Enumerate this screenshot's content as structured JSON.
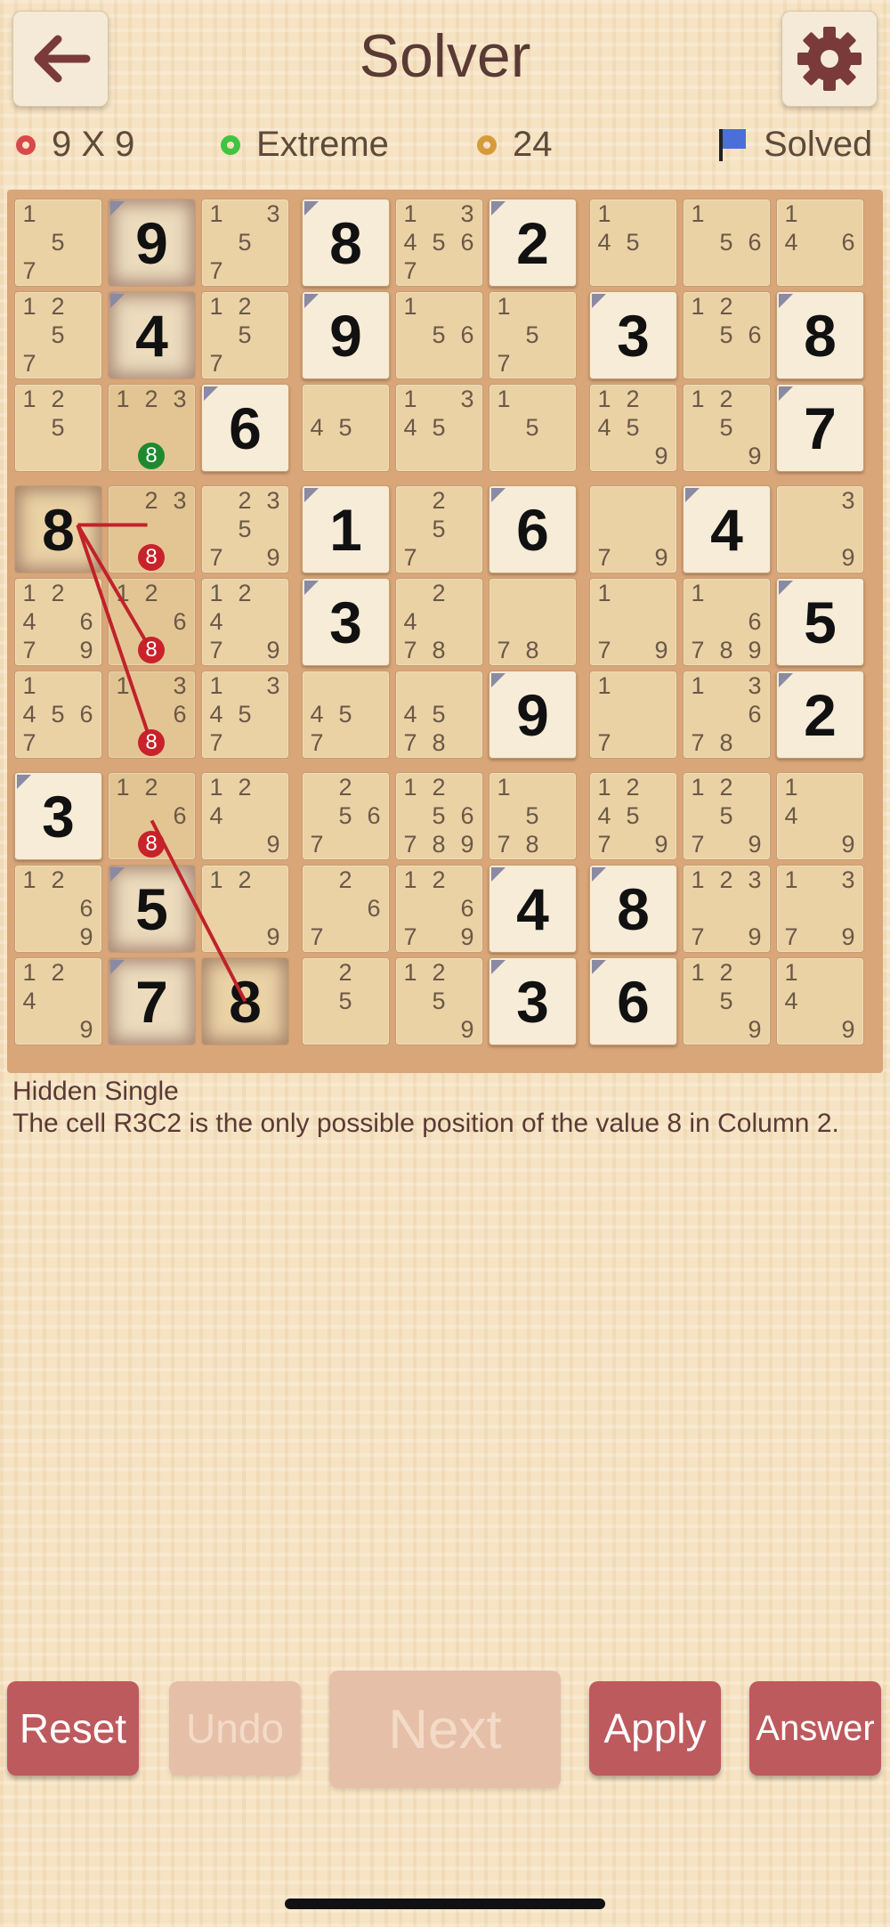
{
  "header": {
    "title": "Solver"
  },
  "status": {
    "size": "9 X 9",
    "difficulty": "Extreme",
    "count": "24",
    "state": "Solved",
    "colors": {
      "size": "#d84a4a",
      "difficulty": "#3fc43f",
      "count": "#d79a3a",
      "flag": "#4a6fd6"
    }
  },
  "board": {
    "given": [
      [
        0,
        9,
        0,
        8,
        0,
        2,
        0,
        0,
        0
      ],
      [
        0,
        4,
        0,
        9,
        0,
        0,
        3,
        0,
        8
      ],
      [
        0,
        0,
        6,
        0,
        0,
        0,
        0,
        0,
        7
      ],
      [
        8,
        0,
        0,
        1,
        0,
        6,
        0,
        4,
        0
      ],
      [
        0,
        0,
        0,
        3,
        0,
        0,
        0,
        0,
        5
      ],
      [
        0,
        0,
        0,
        0,
        0,
        9,
        0,
        0,
        2
      ],
      [
        3,
        0,
        0,
        0,
        0,
        0,
        0,
        0,
        0
      ],
      [
        0,
        5,
        0,
        0,
        0,
        4,
        8,
        0,
        0
      ],
      [
        0,
        7,
        8,
        0,
        0,
        3,
        6,
        0,
        0
      ]
    ],
    "prefilled": [
      [
        0,
        1,
        0,
        1,
        0,
        1,
        0,
        0,
        0
      ],
      [
        0,
        1,
        0,
        1,
        0,
        0,
        1,
        0,
        1
      ],
      [
        0,
        0,
        1,
        0,
        0,
        0,
        0,
        0,
        1
      ],
      [
        0,
        0,
        0,
        1,
        0,
        1,
        0,
        1,
        0
      ],
      [
        0,
        0,
        0,
        1,
        0,
        0,
        0,
        0,
        1
      ],
      [
        0,
        0,
        0,
        0,
        0,
        1,
        0,
        0,
        1
      ],
      [
        1,
        0,
        0,
        0,
        0,
        0,
        0,
        0,
        0
      ],
      [
        0,
        1,
        0,
        0,
        0,
        1,
        1,
        0,
        0
      ],
      [
        0,
        1,
        0,
        0,
        0,
        1,
        1,
        0,
        0
      ]
    ],
    "candidates": [
      [
        [
          1,
          5,
          7
        ],
        [],
        [
          1,
          3,
          5,
          7
        ],
        [],
        [
          1,
          3,
          4,
          5,
          6,
          7
        ],
        [],
        [
          1,
          4,
          5
        ],
        [
          1,
          5,
          6
        ],
        [
          1,
          4,
          6
        ]
      ],
      [
        [
          1,
          2,
          5,
          7
        ],
        [],
        [
          1,
          2,
          5,
          7
        ],
        [],
        [
          1,
          5,
          6
        ],
        [
          1,
          5,
          7
        ],
        [],
        [
          1,
          2,
          5,
          6
        ],
        []
      ],
      [
        [
          1,
          2,
          5
        ],
        [
          1,
          2,
          3,
          8
        ],
        [],
        [
          4,
          5
        ],
        [
          1,
          3,
          4,
          5
        ],
        [
          1,
          5
        ],
        [
          1,
          2,
          4,
          5,
          9
        ],
        [
          1,
          2,
          5,
          9
        ],
        []
      ],
      [
        [],
        [
          2,
          3,
          8
        ],
        [
          2,
          3,
          5,
          7,
          9
        ],
        [],
        [
          2,
          5,
          7
        ],
        [],
        [
          7,
          9
        ],
        [],
        [
          3,
          9
        ]
      ],
      [
        [
          1,
          2,
          4,
          6,
          7,
          9
        ],
        [
          1,
          2,
          6,
          8
        ],
        [
          1,
          2,
          4,
          7,
          9
        ],
        [],
        [
          2,
          4,
          7,
          8
        ],
        [
          7,
          8
        ],
        [
          1,
          7,
          9
        ],
        [
          1,
          6,
          7,
          8,
          9
        ],
        []
      ],
      [
        [
          1,
          4,
          5,
          6,
          7
        ],
        [
          1,
          3,
          6,
          8
        ],
        [
          1,
          3,
          4,
          5,
          7
        ],
        [
          4,
          5,
          7
        ],
        [
          4,
          5,
          7,
          8
        ],
        [],
        [
          1,
          7
        ],
        [
          1,
          3,
          6,
          7,
          8
        ],
        []
      ],
      [
        [],
        [
          1,
          2,
          6,
          8
        ],
        [
          1,
          2,
          4,
          9
        ],
        [
          2,
          5,
          6,
          7
        ],
        [
          1,
          2,
          5,
          6,
          7,
          8,
          9
        ],
        [
          1,
          5,
          7,
          8
        ],
        [
          1,
          2,
          4,
          5,
          7,
          9
        ],
        [
          1,
          2,
          5,
          7,
          9
        ],
        [
          1,
          4,
          9
        ]
      ],
      [
        [
          1,
          2,
          6,
          9
        ],
        [],
        [
          1,
          2,
          9
        ],
        [
          2,
          6,
          7
        ],
        [
          1,
          2,
          6,
          7,
          9
        ],
        [],
        [],
        [
          1,
          2,
          3,
          7,
          9
        ],
        [
          1,
          3,
          7,
          9
        ]
      ],
      [
        [
          1,
          2,
          4,
          9
        ],
        [],
        [],
        [
          2,
          5
        ],
        [
          1,
          2,
          5,
          9
        ],
        [],
        [],
        [
          1,
          2,
          5,
          9
        ],
        [
          1,
          4,
          9
        ]
      ]
    ],
    "highlight_column": 1,
    "red_marks": [
      [
        3,
        1,
        8
      ],
      [
        4,
        1,
        8
      ],
      [
        5,
        1,
        8
      ],
      [
        6,
        1,
        8
      ]
    ],
    "green_marks": [
      [
        2,
        1,
        8
      ]
    ],
    "highlighted_cells": [
      [
        3,
        0
      ],
      [
        0,
        1
      ],
      [
        1,
        1
      ],
      [
        7,
        1
      ],
      [
        8,
        1
      ],
      [
        8,
        2
      ]
    ]
  },
  "hint": {
    "title": "Hidden Single",
    "text": "The cell R3C2 is the only possible position of the value 8 in Column 2."
  },
  "buttons": {
    "reset": "Reset",
    "undo": "Undo",
    "next": "Next",
    "apply": "Apply",
    "answer": "Answer"
  }
}
